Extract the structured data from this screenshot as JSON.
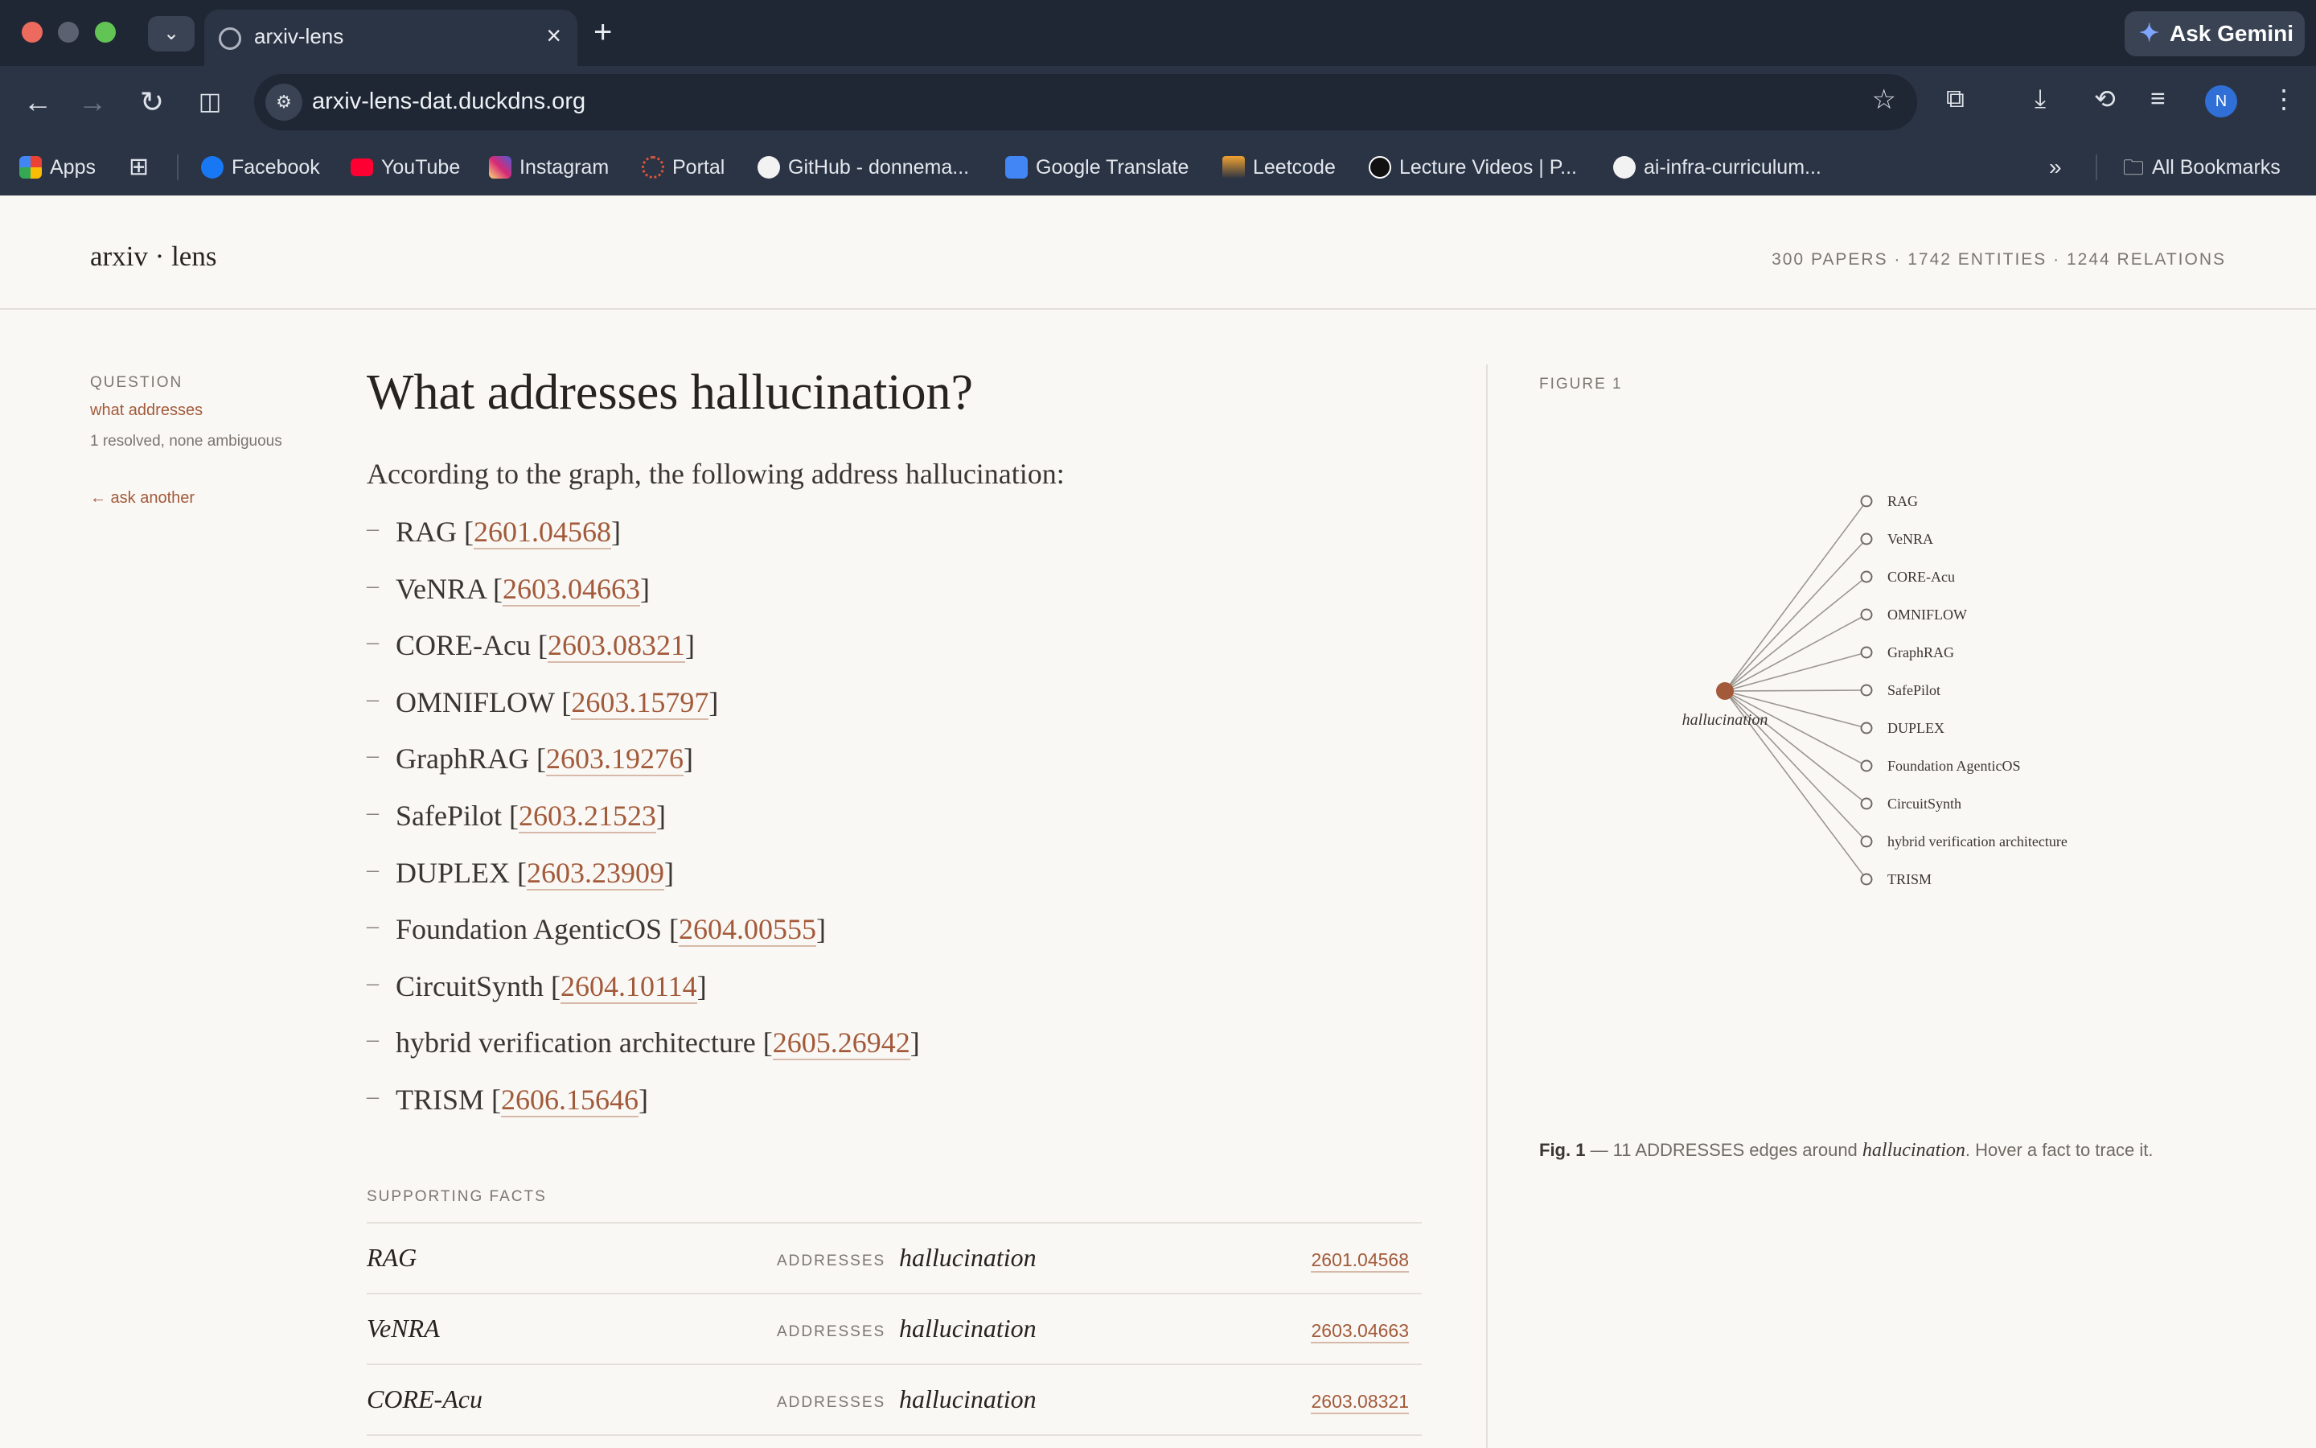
{
  "browser": {
    "tab_title": "arxiv-lens",
    "url": "arxiv-lens-dat.duckdns.org",
    "ask_gemini": "Ask Gemini",
    "profile_initial": "N",
    "bookmarks": [
      {
        "label": "Apps",
        "icon": "apps-grid-icon",
        "color": "#e8a23a"
      },
      {
        "label": "Facebook",
        "icon": "facebook-icon",
        "color": "#1877f2"
      },
      {
        "label": "YouTube",
        "icon": "youtube-icon",
        "color": "#ff0033"
      },
      {
        "label": "Instagram",
        "icon": "instagram-icon",
        "color": "#d62976"
      },
      {
        "label": "Portal",
        "icon": "portal-icon",
        "color": "#e0553a"
      },
      {
        "label": "GitHub - donnema...",
        "icon": "github-icon",
        "color": "#ffffff"
      },
      {
        "label": "Google Translate",
        "icon": "translate-icon",
        "color": "#4285f4"
      },
      {
        "label": "Leetcode",
        "icon": "leetcode-icon",
        "color": "#f0a130"
      },
      {
        "label": "Lecture Videos | P...",
        "icon": "lecture-icon",
        "color": "#ffffff"
      },
      {
        "label": "ai-infra-curriculum...",
        "icon": "github-icon",
        "color": "#ffffff"
      }
    ],
    "all_bookmarks": "All Bookmarks"
  },
  "site": {
    "logo": "arxiv · lens",
    "stats": "300 PAPERS · 1742 ENTITIES · 1244 RELATIONS"
  },
  "sidebar": {
    "question_label": "QUESTION",
    "question_type": "what addresses",
    "resolution_note": "1 resolved, none ambiguous",
    "ask_another": "← ask another"
  },
  "main": {
    "title": "What addresses hallucination?",
    "answer_intro": "According to the graph, the following address hallucination:",
    "results": [
      {
        "name": "RAG",
        "id": "2601.04568"
      },
      {
        "name": "VeNRA",
        "id": "2603.04663"
      },
      {
        "name": "CORE-Acu",
        "id": "2603.08321"
      },
      {
        "name": "OMNIFLOW",
        "id": "2603.15797"
      },
      {
        "name": "GraphRAG",
        "id": "2603.19276"
      },
      {
        "name": "SafePilot",
        "id": "2603.21523"
      },
      {
        "name": "DUPLEX",
        "id": "2603.23909"
      },
      {
        "name": "Foundation AgenticOS",
        "id": "2604.00555"
      },
      {
        "name": "CircuitSynth",
        "id": "2604.10114"
      },
      {
        "name": "hybrid verification architecture",
        "id": "2605.26942"
      },
      {
        "name": "TRISM",
        "id": "2606.15646"
      }
    ],
    "supporting_label": "SUPPORTING FACTS",
    "facts": [
      {
        "subject": "RAG",
        "relation": "ADDRESSES",
        "object": "hallucination",
        "id": "2601.04568"
      },
      {
        "subject": "VeNRA",
        "relation": "ADDRESSES",
        "object": "hallucination",
        "id": "2603.04663"
      },
      {
        "subject": "CORE-Acu",
        "relation": "ADDRESSES",
        "object": "hallucination",
        "id": "2603.08321"
      }
    ]
  },
  "figure": {
    "label": "FIGURE 1",
    "center": "hallucination",
    "leaves": [
      "RAG",
      "VeNRA",
      "CORE-Acu",
      "OMNIFLOW",
      "GraphRAG",
      "SafePilot",
      "DUPLEX",
      "Foundation AgenticOS",
      "CircuitSynth",
      "hybrid verification architecture",
      "TRISM"
    ],
    "caption_prefix": "Fig. 1",
    "caption_middle": " — 11 ADDRESSES edges around ",
    "caption_term": "hallucination",
    "caption_suffix": ". Hover a fact to trace it.",
    "accent_color": "#a25a3a"
  }
}
